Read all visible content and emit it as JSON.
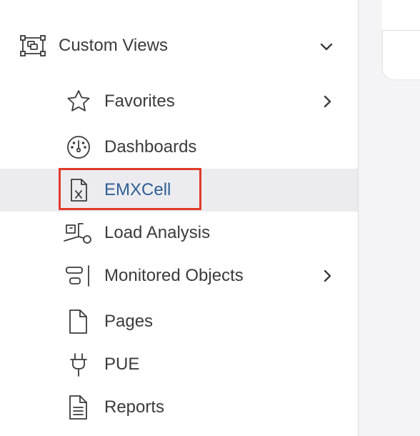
{
  "sidebar": {
    "section": {
      "label": "Custom Views",
      "icon": "custom-views-icon",
      "expanded": true
    },
    "items": [
      {
        "label": "Favorites",
        "icon": "star-icon",
        "has_submenu": true
      },
      {
        "label": "Dashboards",
        "icon": "dashboard-gauge-icon",
        "has_submenu": false
      },
      {
        "label": "EMXCell",
        "icon": "excel-file-icon",
        "has_submenu": false,
        "active": true,
        "highlighted": true
      },
      {
        "label": "Load Analysis",
        "icon": "load-analysis-icon",
        "has_submenu": false
      },
      {
        "label": "Monitored Objects",
        "icon": "monitored-objects-icon",
        "has_submenu": true
      },
      {
        "label": "Pages",
        "icon": "page-icon",
        "has_submenu": false
      },
      {
        "label": "PUE",
        "icon": "plug-icon",
        "has_submenu": false
      },
      {
        "label": "Reports",
        "icon": "report-icon",
        "has_submenu": false
      }
    ]
  },
  "colors": {
    "active_text": "#2f5f94",
    "active_background": "#ececf0",
    "highlight_border": "#e13a2a",
    "text": "#3b3b3b"
  }
}
